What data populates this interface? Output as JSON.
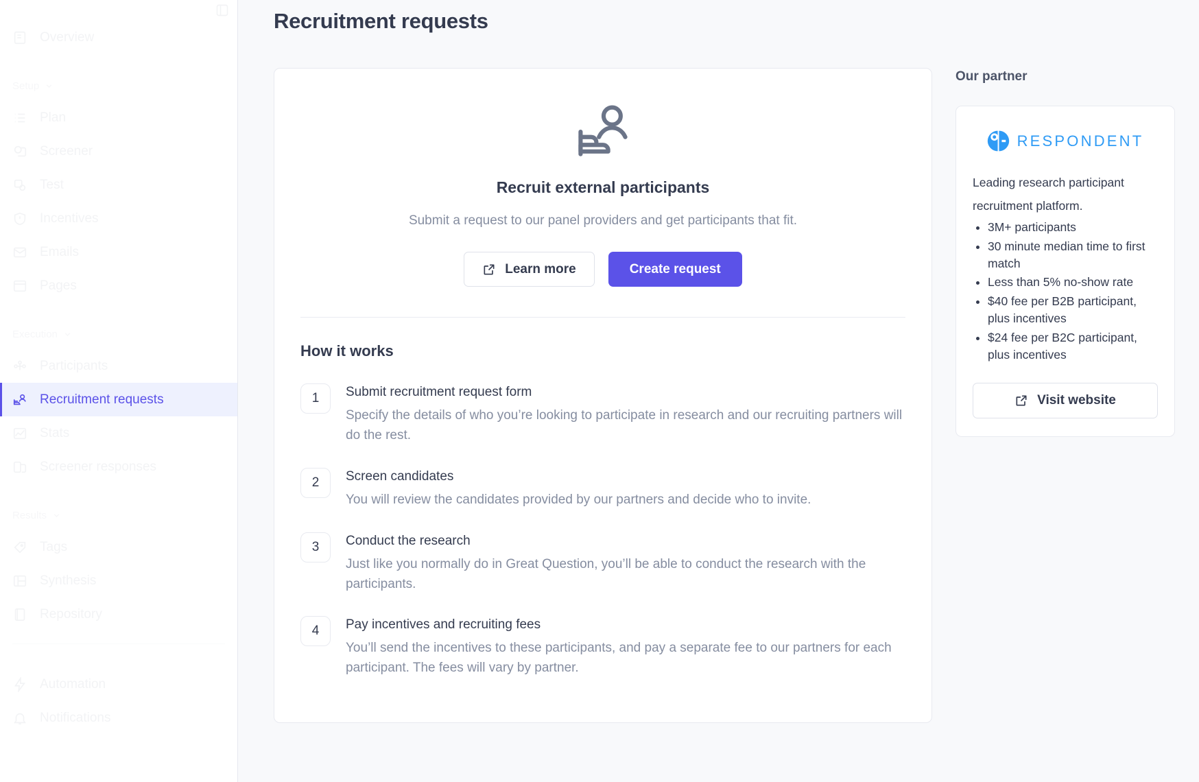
{
  "sidebar": {
    "toggle_icon": "panel-collapse-icon",
    "top_items": [
      {
        "label": "Overview",
        "icon": "overview-icon"
      }
    ],
    "groups": [
      {
        "label": "Setup",
        "items": [
          {
            "label": "Plan",
            "icon": "list-icon"
          },
          {
            "label": "Screener",
            "icon": "screener-icon"
          },
          {
            "label": "Test",
            "icon": "test-icon"
          },
          {
            "label": "Incentives",
            "icon": "shield-icon"
          },
          {
            "label": "Emails",
            "icon": "mail-icon"
          },
          {
            "label": "Pages",
            "icon": "pages-icon"
          }
        ]
      },
      {
        "label": "Execution",
        "items": [
          {
            "label": "Participants",
            "icon": "participants-icon"
          },
          {
            "label": "Recruitment requests",
            "icon": "recruitment-icon",
            "active": true
          },
          {
            "label": "Stats",
            "icon": "stats-icon"
          },
          {
            "label": "Screener responses",
            "icon": "screener-responses-icon"
          }
        ]
      },
      {
        "label": "Results",
        "items": [
          {
            "label": "Tags",
            "icon": "tag-icon"
          },
          {
            "label": "Synthesis",
            "icon": "synthesis-icon"
          },
          {
            "label": "Repository",
            "icon": "repository-icon"
          }
        ]
      }
    ],
    "footer_items": [
      {
        "label": "Automation",
        "icon": "bolt-icon"
      },
      {
        "label": "Notifications",
        "icon": "bell-icon"
      }
    ]
  },
  "header": {
    "title": "Recruitment requests"
  },
  "hero": {
    "icon": "recruit-participant-icon",
    "title": "Recruit external participants",
    "subtitle": "Submit a request to our panel providers and get participants that fit.",
    "learn_more_label": "Learn more",
    "learn_more_icon": "external-link-icon",
    "create_request_label": "Create request",
    "primary_color": "#5b52e8"
  },
  "how_it_works": {
    "title": "How it works",
    "steps": [
      {
        "number": "1",
        "heading": "Submit recruitment request form",
        "description": "Specify the details of who you’re looking to participate in research and our recruiting partners will do the rest."
      },
      {
        "number": "2",
        "heading": "Screen candidates",
        "description": "You will review the candidates provided by our partners and decide who to invite."
      },
      {
        "number": "3",
        "heading": "Conduct the research",
        "description": "Just like you normally do in Great Question, you’ll be able to conduct the research with the participants."
      },
      {
        "number": "4",
        "heading": "Pay incentives and recruiting fees",
        "description": "You’ll send the incentives to these participants, and pay a separate fee to our partners for each participant. The fees will vary by partner."
      }
    ]
  },
  "partner": {
    "section_label": "Our partner",
    "logo_icon": "respondent-logo-icon",
    "logo_text": "RESPONDENT",
    "logo_color": "#2f9bf5",
    "description": "Leading research participant recruitment platform.",
    "bullets": [
      "3M+ participants",
      "30 minute median time to first match",
      "Less than 5% no-show rate",
      "$40 fee per B2B participant, plus incentives",
      "$24 fee per B2C participant, plus incentives"
    ],
    "visit_label": "Visit website",
    "visit_icon": "external-link-icon"
  }
}
